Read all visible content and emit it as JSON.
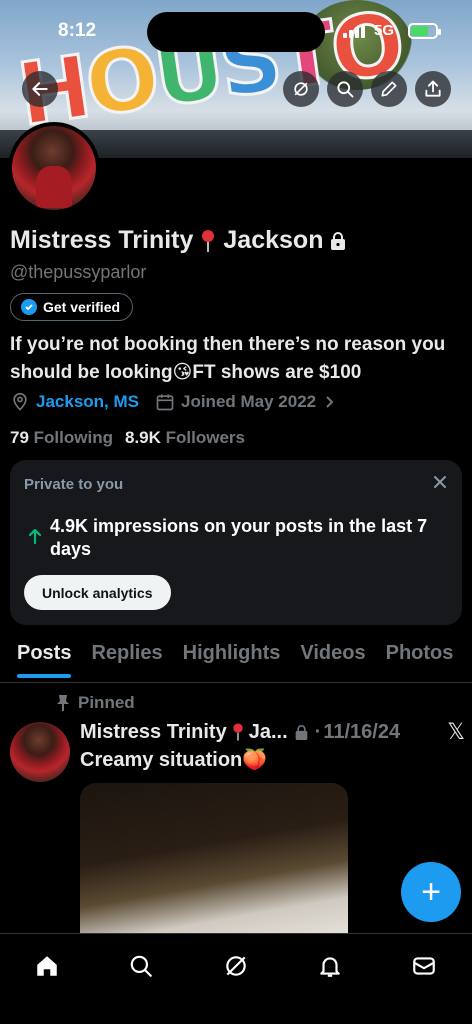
{
  "status": {
    "time": "8:12",
    "network": "5G"
  },
  "banner": {
    "sign_text": "HOUSTON"
  },
  "profile": {
    "name_first": "Mistress Trinity",
    "name_last": "Jackson",
    "handle": "@thepussyparlor",
    "verify_label": "Get verified",
    "bio": "If you’re not booking then there’s no reason you should be looking😘FT shows are $100",
    "location": "Jackson, MS",
    "joined": "Joined May 2022",
    "following_count": "79",
    "following_label": "Following",
    "followers_count": "8.9K",
    "followers_label": "Followers"
  },
  "analytics": {
    "title": "Private to you",
    "impressions_text": "4.9K impressions on your posts in the last 7 days",
    "unlock_label": "Unlock analytics"
  },
  "tabs": [
    {
      "label": "Posts"
    },
    {
      "label": "Replies"
    },
    {
      "label": "Highlights"
    },
    {
      "label": "Videos"
    },
    {
      "label": "Photos"
    }
  ],
  "post": {
    "pinned_label": "Pinned",
    "author": "Mistress Trinity",
    "author_suffix": "Ja...",
    "date": "11/16/24",
    "text": "Creamy situation🍑"
  },
  "fab": {
    "label": "+"
  },
  "colors": {
    "accent": "#1d9bf0",
    "background": "#000000",
    "card": "#16181c",
    "muted": "#71767b",
    "positive": "#00ba7c"
  },
  "icons": [
    "back-arrow-icon",
    "grok-icon",
    "search-icon",
    "edit-icon",
    "share-icon",
    "lock-icon",
    "pin-marker-icon",
    "calendar-icon",
    "chevron-right-icon",
    "close-icon",
    "trend-up-arrow-icon",
    "pin-icon",
    "x-logo-icon",
    "home-icon",
    "grok-icon",
    "bell-icon",
    "mail-icon"
  ]
}
